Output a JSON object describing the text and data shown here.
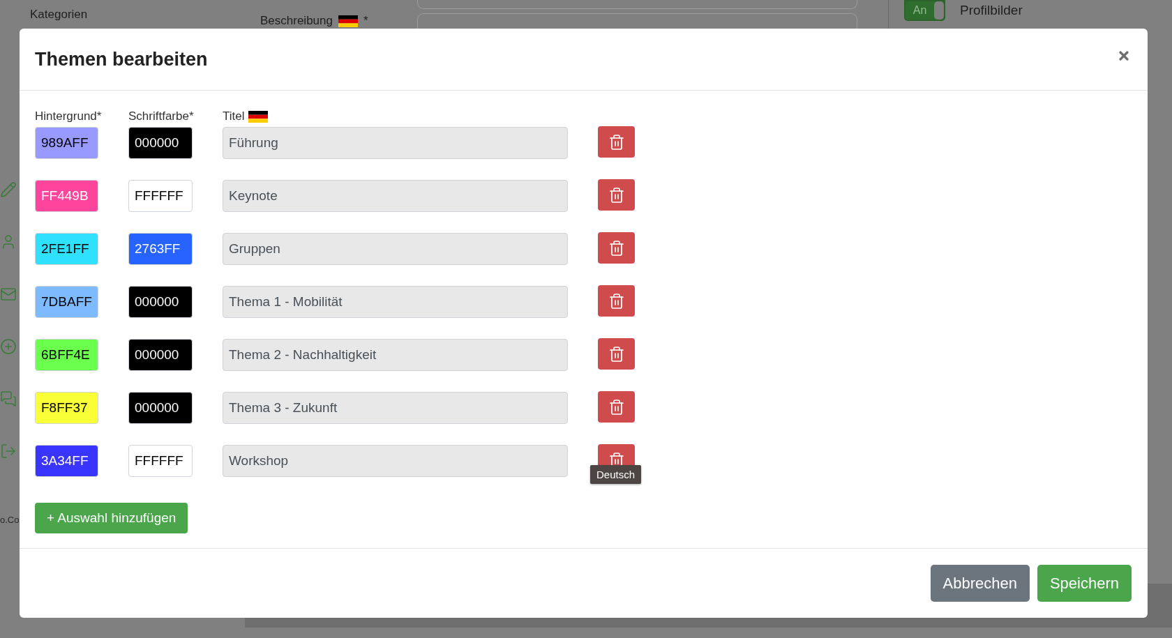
{
  "page_behind": {
    "section_label": "Kategorien",
    "field_label": {
      "text": "Beschreibung",
      "has_flag": true,
      "required_mark": "*"
    },
    "toggle": {
      "label": "An",
      "on": true,
      "caption": "Profilbilder"
    },
    "sidebar_text": "o.Co"
  },
  "dialog": {
    "title": "Themen bearbeiten",
    "columns": [
      {
        "label": "Hintergrund*",
        "has_flag": false
      },
      {
        "label": "Schriftfarbe*",
        "has_flag": false
      },
      {
        "label": "Titel",
        "has_flag": true
      }
    ],
    "rows": [
      {
        "background": {
          "value": "989AFF",
          "color": "#989aff"
        },
        "font_color": {
          "value": "000000",
          "color": "#000000"
        },
        "title": "Führung"
      },
      {
        "background": {
          "value": "FF449B",
          "color": "#ff449b"
        },
        "font_color": {
          "value": "FFFFFF",
          "color": "#ffffff"
        },
        "title": "Keynote"
      },
      {
        "background": {
          "value": "2FE1FF",
          "color": "#2fe1ff"
        },
        "font_color": {
          "value": "2763FF",
          "color": "#2763ff"
        },
        "title": "Gruppen"
      },
      {
        "background": {
          "value": "7DBAFF",
          "color": "#7dbaff"
        },
        "font_color": {
          "value": "000000",
          "color": "#000000"
        },
        "title": "Thema 1 - Mobilität"
      },
      {
        "background": {
          "value": "6BFF4E",
          "color": "#6bff4e"
        },
        "font_color": {
          "value": "000000",
          "color": "#000000"
        },
        "title": "Thema 2 - Nachhaltigkeit"
      },
      {
        "background": {
          "value": "F8FF37",
          "color": "#f8ff37"
        },
        "font_color": {
          "value": "000000",
          "color": "#000000"
        },
        "title": "Thema 3 - Zukunft"
      },
      {
        "background": {
          "value": "3A34FF",
          "color": "#3a34ff"
        },
        "font_color": {
          "value": "FFFFFF",
          "color": "#ffffff"
        },
        "title": "Workshop",
        "tooltip": "Deutsch"
      }
    ],
    "add_button": "+ Auswahl hinzufügen",
    "buttons": [
      {
        "label": "Abbrechen",
        "kind": "secondary"
      },
      {
        "label": "Speichern",
        "kind": "primary"
      }
    ]
  }
}
